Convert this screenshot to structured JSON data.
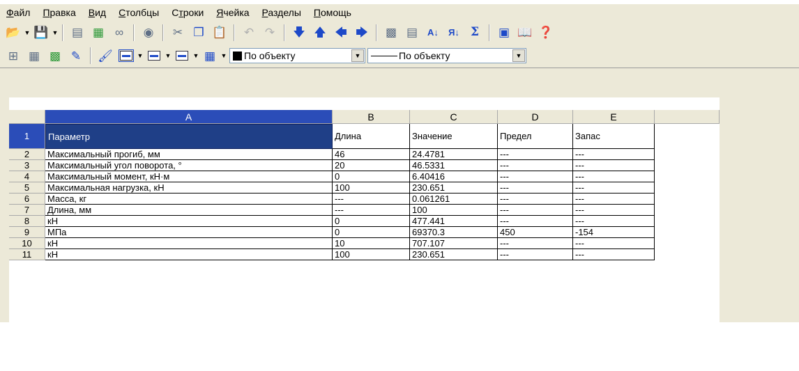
{
  "menu": [
    {
      "text": "Файл",
      "u": "Ф"
    },
    {
      "text": "Правка",
      "u": "П"
    },
    {
      "text": "Вид",
      "u": "В"
    },
    {
      "text": "Столбцы",
      "u": "С"
    },
    {
      "text": "Строки",
      "u": "т"
    },
    {
      "text": "Ячейка",
      "u": "Я"
    },
    {
      "text": "Разделы",
      "u": "Р"
    },
    {
      "text": "Помощь",
      "u": "П"
    }
  ],
  "toolbar2": {
    "color_value": "По объекту",
    "line_value": "По объекту"
  },
  "columns": [
    "A",
    "B",
    "C",
    "D",
    "E"
  ],
  "rows": [
    {
      "n": "1",
      "cells": [
        "Параметр",
        "Длина",
        "Значение",
        "Предел",
        "Запас"
      ]
    },
    {
      "n": "2",
      "cells": [
        "Максимальный прогиб, мм",
        "46",
        "24.4781",
        "---",
        "---"
      ]
    },
    {
      "n": "3",
      "cells": [
        "Максимальный угол поворота, °",
        "20",
        "46.5331",
        "---",
        "---"
      ]
    },
    {
      "n": "4",
      "cells": [
        "Максимальный момент, кН·м",
        "0",
        "6.40416",
        "---",
        "---"
      ]
    },
    {
      "n": "5",
      "cells": [
        "Максимальная нагрузка, кН",
        "100",
        "230.651",
        "---",
        "---"
      ]
    },
    {
      "n": "6",
      "cells": [
        "Масса, кг",
        "---",
        "0.061261",
        "---",
        "---"
      ]
    },
    {
      "n": "7",
      "cells": [
        "Длина, мм",
        "---",
        "100",
        "---",
        "---"
      ]
    },
    {
      "n": "8",
      "cells": [
        "кН",
        "0",
        "477.441",
        "---",
        "---"
      ]
    },
    {
      "n": "9",
      "cells": [
        "МПа",
        "0",
        "69370.3",
        "450",
        "-154"
      ]
    },
    {
      "n": "10",
      "cells": [
        "кН",
        "10",
        "707.107",
        "---",
        "---"
      ]
    },
    {
      "n": "11",
      "cells": [
        "кН",
        "100",
        "230.651",
        "---",
        "---"
      ]
    }
  ],
  "colors": {
    "chrome": "#ece9d8",
    "selection": "#1f3f87",
    "header_active": "#2b4db8"
  }
}
